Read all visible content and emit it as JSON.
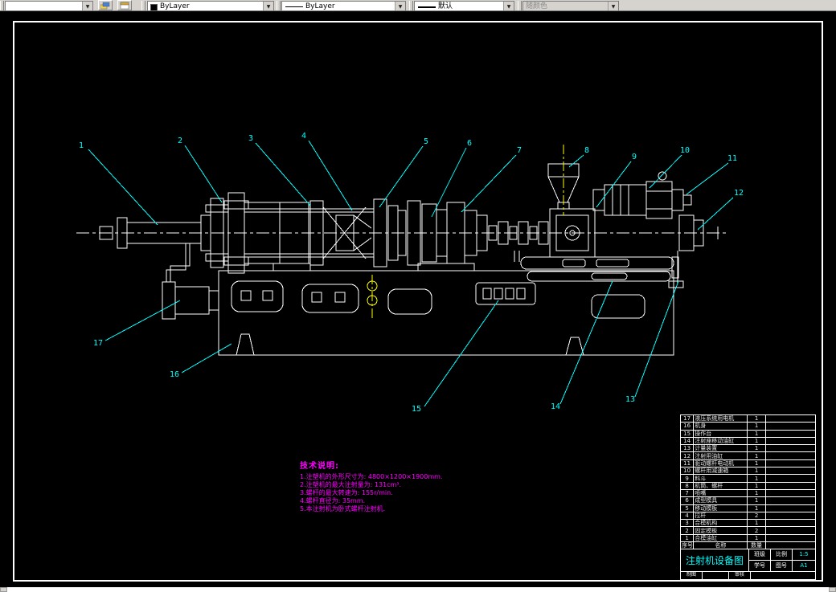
{
  "toolbar": {
    "layer": {
      "value": ""
    },
    "color": {
      "value": "ByLayer"
    },
    "linetype": {
      "value": "ByLayer"
    },
    "lineweight": {
      "value": "默认"
    },
    "plot_style": {
      "value": "随颜色"
    }
  },
  "icons": {
    "dropdown": "▼"
  },
  "colors": {
    "background": "#000000",
    "drawing_line": "#ffffff",
    "callout": "#00ffff",
    "notes": "#ff00ff",
    "centerline_accent": "#ffff00"
  },
  "callouts": [
    {
      "label": "1"
    },
    {
      "label": "2"
    },
    {
      "label": "3"
    },
    {
      "label": "4"
    },
    {
      "label": "5"
    },
    {
      "label": "6"
    },
    {
      "label": "7"
    },
    {
      "label": "8"
    },
    {
      "label": "9"
    },
    {
      "label": "10"
    },
    {
      "label": "11"
    },
    {
      "label": "12"
    },
    {
      "label": "13"
    },
    {
      "label": "14"
    },
    {
      "label": "15"
    },
    {
      "label": "16"
    },
    {
      "label": "17"
    }
  ],
  "notes": {
    "title": "技术说明:",
    "lines": [
      "1.注塑机的外形尺寸为: 4800×1200×1900mm.",
      "2.注塑机的最大注射量为: 131cm³.",
      "3.螺杆的最大转速为: 155r/min.",
      "4.螺杆直径为: 35mm.",
      "5.本注射机为卧式螺杆注射机."
    ]
  },
  "bom": {
    "headers": {
      "no": "序号",
      "name": "名称",
      "qty": "数量",
      "remark": ""
    },
    "rows": [
      {
        "no": "17",
        "name": "液压系统用电机",
        "qty": "1",
        "remark": ""
      },
      {
        "no": "16",
        "name": "机身",
        "qty": "1",
        "remark": ""
      },
      {
        "no": "15",
        "name": "操作台",
        "qty": "1",
        "remark": ""
      },
      {
        "no": "14",
        "name": "注射座移动油缸",
        "qty": "1",
        "remark": ""
      },
      {
        "no": "13",
        "name": "计量装置",
        "qty": "1",
        "remark": ""
      },
      {
        "no": "12",
        "name": "注射用油缸",
        "qty": "1",
        "remark": ""
      },
      {
        "no": "11",
        "name": "驱动螺杆电动机",
        "qty": "1",
        "remark": ""
      },
      {
        "no": "10",
        "name": "螺杆用减速箱",
        "qty": "1",
        "remark": ""
      },
      {
        "no": "9",
        "name": "料斗",
        "qty": "1",
        "remark": ""
      },
      {
        "no": "8",
        "name": "机筒、螺杆",
        "qty": "1",
        "remark": ""
      },
      {
        "no": "7",
        "name": "喷嘴",
        "qty": "1",
        "remark": ""
      },
      {
        "no": "6",
        "name": "成型模具",
        "qty": "1",
        "remark": ""
      },
      {
        "no": "5",
        "name": "移动模板",
        "qty": "1",
        "remark": ""
      },
      {
        "no": "4",
        "name": "拉杆",
        "qty": "2",
        "remark": ""
      },
      {
        "no": "3",
        "name": "合模机构",
        "qty": "1",
        "remark": ""
      },
      {
        "no": "2",
        "name": "固定模板",
        "qty": "2",
        "remark": ""
      },
      {
        "no": "1",
        "name": "合模油缸",
        "qty": "1",
        "remark": ""
      }
    ]
  },
  "title_block": {
    "title": "注射机设备图",
    "class_label": "班级",
    "scale_label": "比例",
    "scale_value": "1:5",
    "id_label": "学号",
    "sheet_label": "图号",
    "sheet_value": "A1",
    "draw_label": "制图",
    "check_label": "审核"
  }
}
